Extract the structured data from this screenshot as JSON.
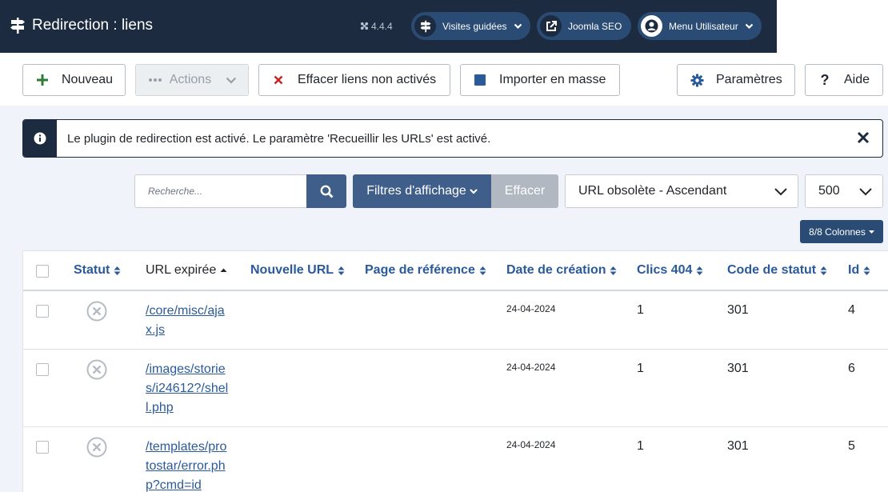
{
  "header": {
    "title": "Redirection : liens",
    "version": "4.4.4",
    "guided_tours": "Visites guidées",
    "joomla_seo": "Joomla SEO",
    "user_menu": "Menu Utilisateur"
  },
  "toolbar": {
    "new_label": "Nouveau",
    "actions_label": "Actions",
    "clear_inactive_label": "Effacer liens non activés",
    "bulk_import_label": "Importer en masse",
    "options_label": "Paramètres",
    "help_label": "Aide"
  },
  "alert": {
    "message": "Le plugin de redirection est activé. Le paramètre 'Recueillir les URLs' est activé."
  },
  "filters": {
    "search_placeholder": "Recherche...",
    "filter_options_label": "Filtres d'affichage",
    "clear_label": "Effacer",
    "ordering_value": "URL obsolète - Ascendant",
    "limit_value": "500",
    "columns_label": "8/8 Colonnes"
  },
  "table": {
    "headers": {
      "status": "Statut",
      "old_url": "URL expirée",
      "new_url": "Nouvelle URL",
      "referer": "Page de référence",
      "created": "Date de création",
      "hits": "Clics 404",
      "header": "Code de statut",
      "id": "Id"
    },
    "rows": [
      {
        "old_url": "/core/misc/ajax.js",
        "new_url": "",
        "referer": "",
        "created": "24-04-2024",
        "hits": "1",
        "header": "301",
        "id": "4"
      },
      {
        "old_url": "/images/stories/i24612?/shell.php",
        "new_url": "",
        "referer": "",
        "created": "24-04-2024",
        "hits": "1",
        "header": "301",
        "id": "6"
      },
      {
        "old_url": "/templates/protostar/error.php?cmd=id",
        "new_url": "",
        "referer": "",
        "created": "24-04-2024",
        "hits": "1",
        "header": "301",
        "id": "5"
      }
    ]
  },
  "colors": {
    "header_bg": "#1c2b3f",
    "primary_btn": "#3f5f8a",
    "link": "#2a5a9a",
    "new_icon": "#2e7d32",
    "delete_icon": "#c62828",
    "import_icon": "#2a5a9a"
  },
  "icons": {
    "logo": "signpost-icon",
    "version": "joomla-icon",
    "guided_tours": "signpost-icon",
    "joomla_seo": "external-link-icon",
    "user_menu": "user-circle-icon",
    "new": "plus-icon",
    "actions": "ellipsis-icon",
    "clear_inactive": "times-icon",
    "bulk_import": "square-icon",
    "options": "gear-icon",
    "help": "question-icon",
    "alert": "info-icon",
    "search": "search-icon",
    "status_unpublished": "times-circle-icon"
  }
}
